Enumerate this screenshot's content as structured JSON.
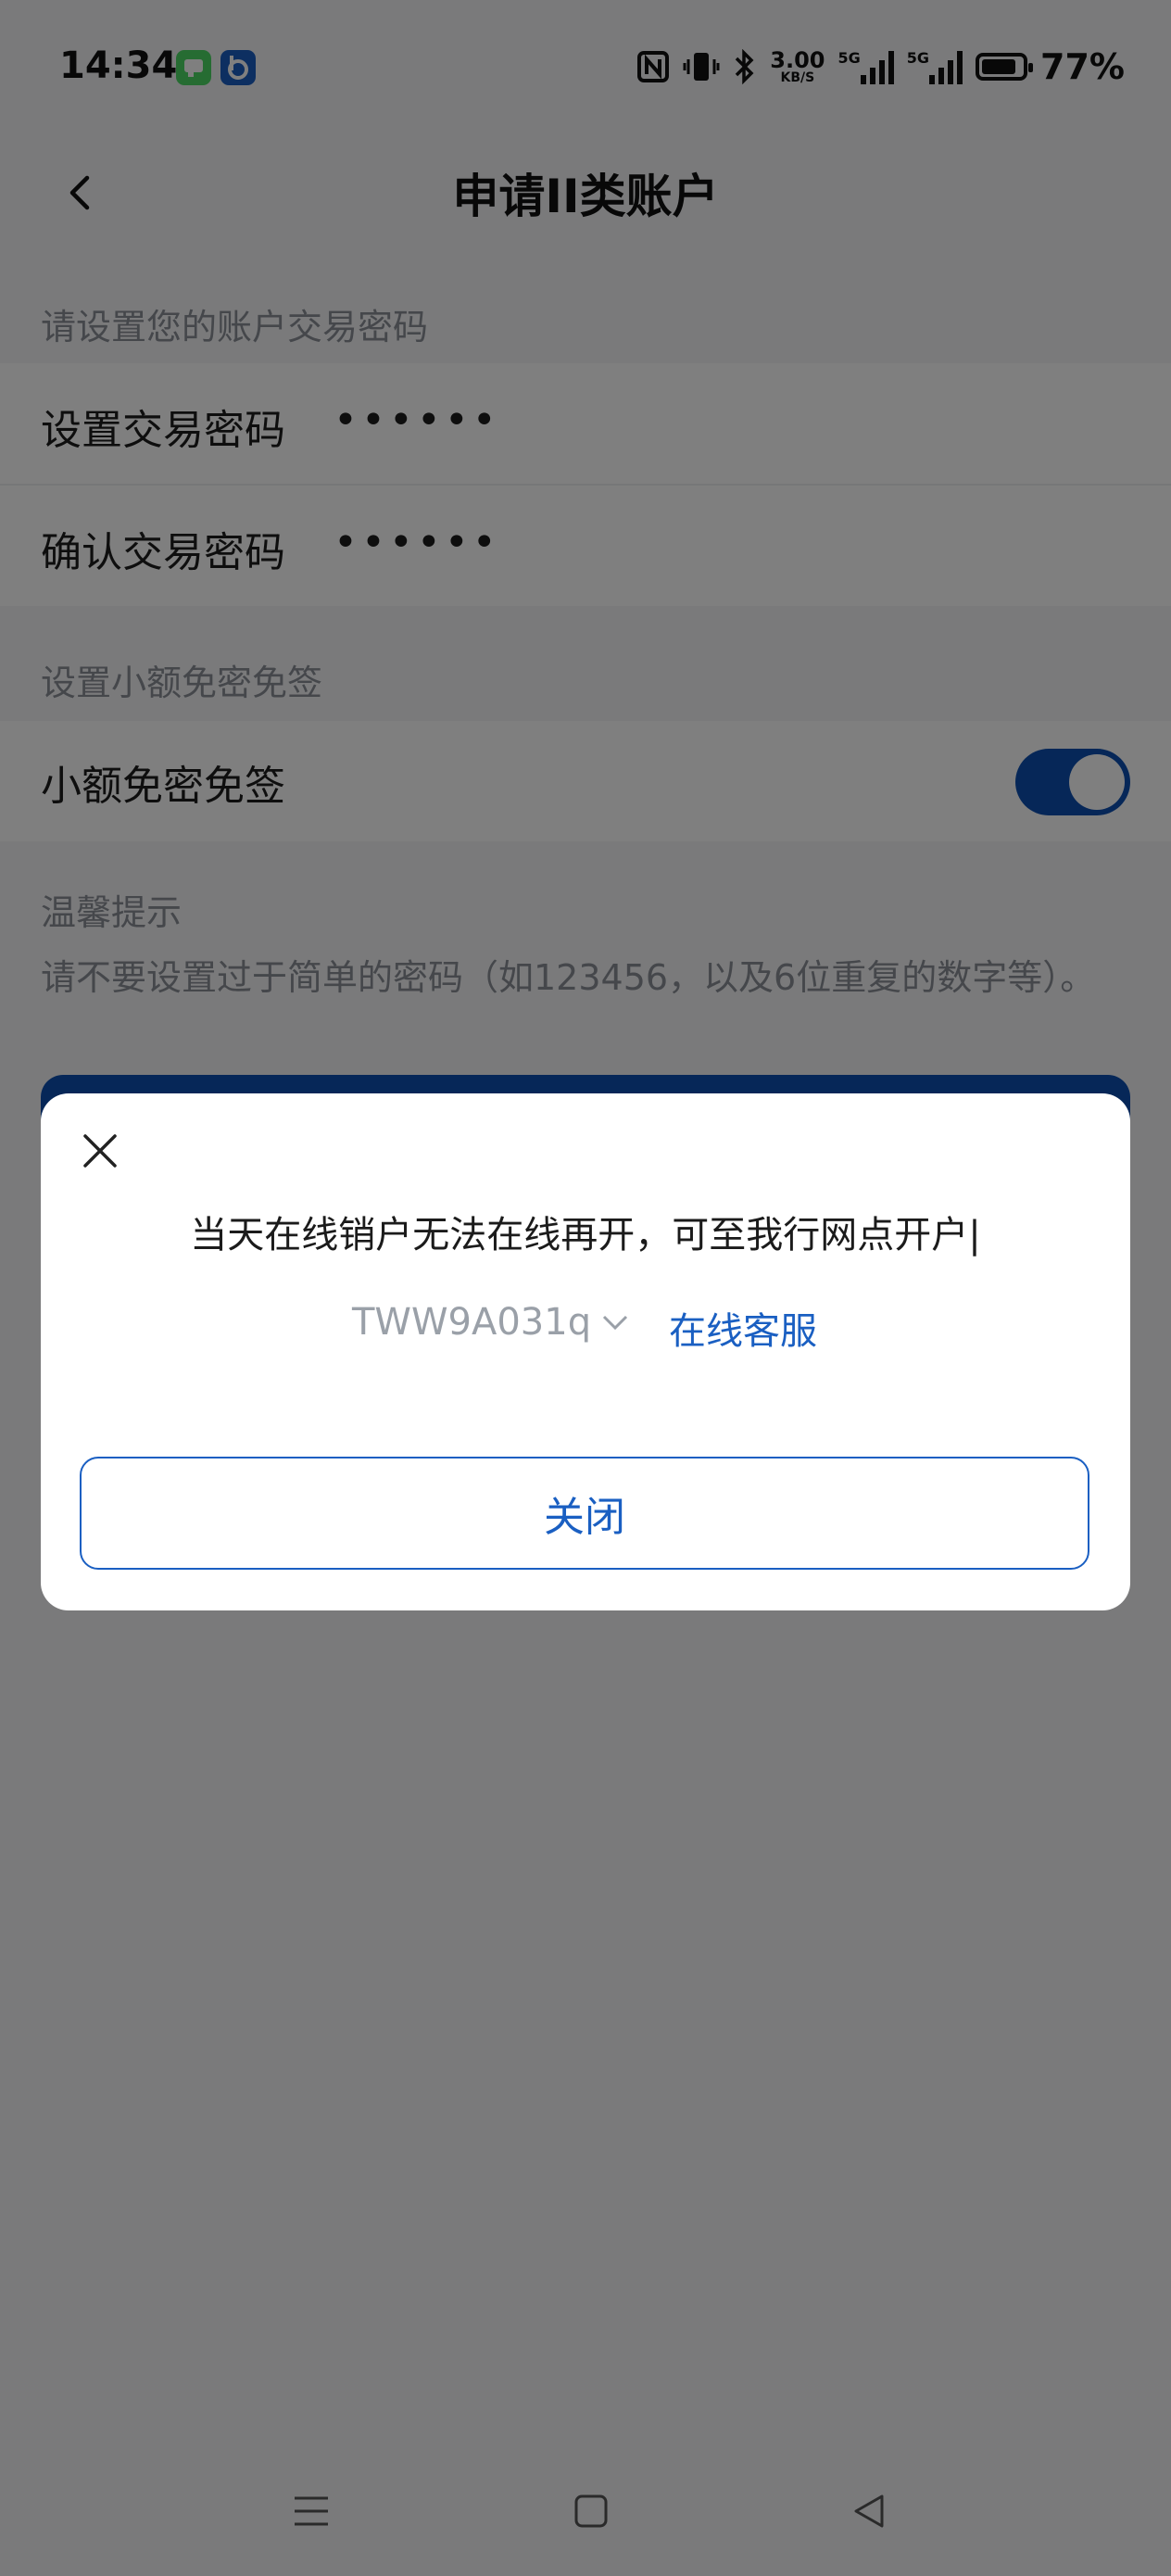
{
  "status_bar": {
    "time": "14:34",
    "net_speed_top": "3.00",
    "net_speed_bottom": "KB/S",
    "network": "5G",
    "battery": "77%",
    "battery_level": 0.77,
    "icons": [
      "messages-app-icon",
      "baidu-app-icon",
      "nfc-icon",
      "vibrate-icon",
      "bluetooth-icon",
      "signal-icon",
      "signal-icon",
      "battery-icon"
    ]
  },
  "nav": {
    "title": "申请II类账户",
    "back_icon": "chevron-left-icon"
  },
  "sections": {
    "password_header": "请设置您的账户交易密码",
    "set_password_label": "设置交易密码",
    "set_password_value": "••••••",
    "confirm_password_label": "确认交易密码",
    "confirm_password_value": "••••••",
    "free_sign_header": "设置小额免密免签",
    "free_sign_label": "小额免密免签",
    "free_sign_on": true
  },
  "tips": {
    "title": "温馨提示",
    "text": "请不要设置过于简单的密码（如123456，以及6位重复的数字等）。"
  },
  "dialog": {
    "message": "当天在线销户无法在线再开，可至我行网点开户|",
    "code": "TWW9A031q",
    "service_link": "在线客服",
    "close_label": "关闭",
    "close_icon": "close-icon"
  },
  "colors": {
    "accent": "#0d4fb0",
    "link": "#1a5fc2",
    "muted": "#8a8f97"
  }
}
